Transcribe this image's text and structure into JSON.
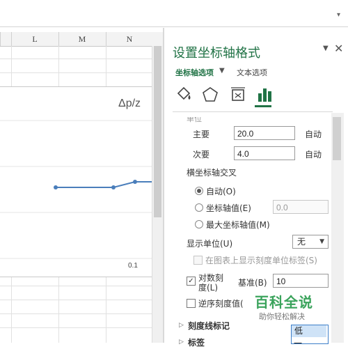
{
  "sheet": {
    "columns": [
      "L",
      "M",
      "N"
    ],
    "chart": {
      "title": "Δp/z",
      "x_tick": "0.1"
    }
  },
  "chart_data": {
    "type": "line",
    "title": "Δp/z",
    "series": [
      {
        "values": [
          1,
          1,
          1.04,
          1.04
        ]
      }
    ],
    "x_ticks": [
      "0.1"
    ]
  },
  "pane": {
    "title": "设置坐标轴格式",
    "tabs": {
      "axis_options": "坐标轴选项",
      "text_options": "文本选项"
    },
    "icons": [
      "fill-line-icon",
      "effects-pentagon-icon",
      "size-properties-icon",
      "axis-options-bar-chart-icon"
    ],
    "units": {
      "heading": "单位",
      "major": {
        "label": "主要",
        "value": "20.0",
        "auto": "自动"
      },
      "minor": {
        "label": "次要",
        "value": "4.0",
        "auto": "自动"
      }
    },
    "crosses": {
      "heading": "横坐标轴交叉",
      "auto": "自动(O)",
      "axis_value": "坐标轴值(E)",
      "axis_value_input": "0.0",
      "max_value": "最大坐标轴值(M)"
    },
    "display_units": {
      "label": "显示单位(U)",
      "value": "无",
      "show_label": "在图表上显示刻度单位标签(S)"
    },
    "log_scale": {
      "label_line1": "对数刻",
      "label_line2": "度(L)",
      "base_label": "基准(B)",
      "base_value": "10"
    },
    "reverse": {
      "label": "逆序刻度值("
    },
    "sections": {
      "tick_marks": "刻度线标记",
      "labels": "标签"
    },
    "dropdown": {
      "selected": "低",
      "next": "一"
    }
  },
  "watermark": {
    "big": "百科全说",
    "small": "助你轻松解决"
  }
}
